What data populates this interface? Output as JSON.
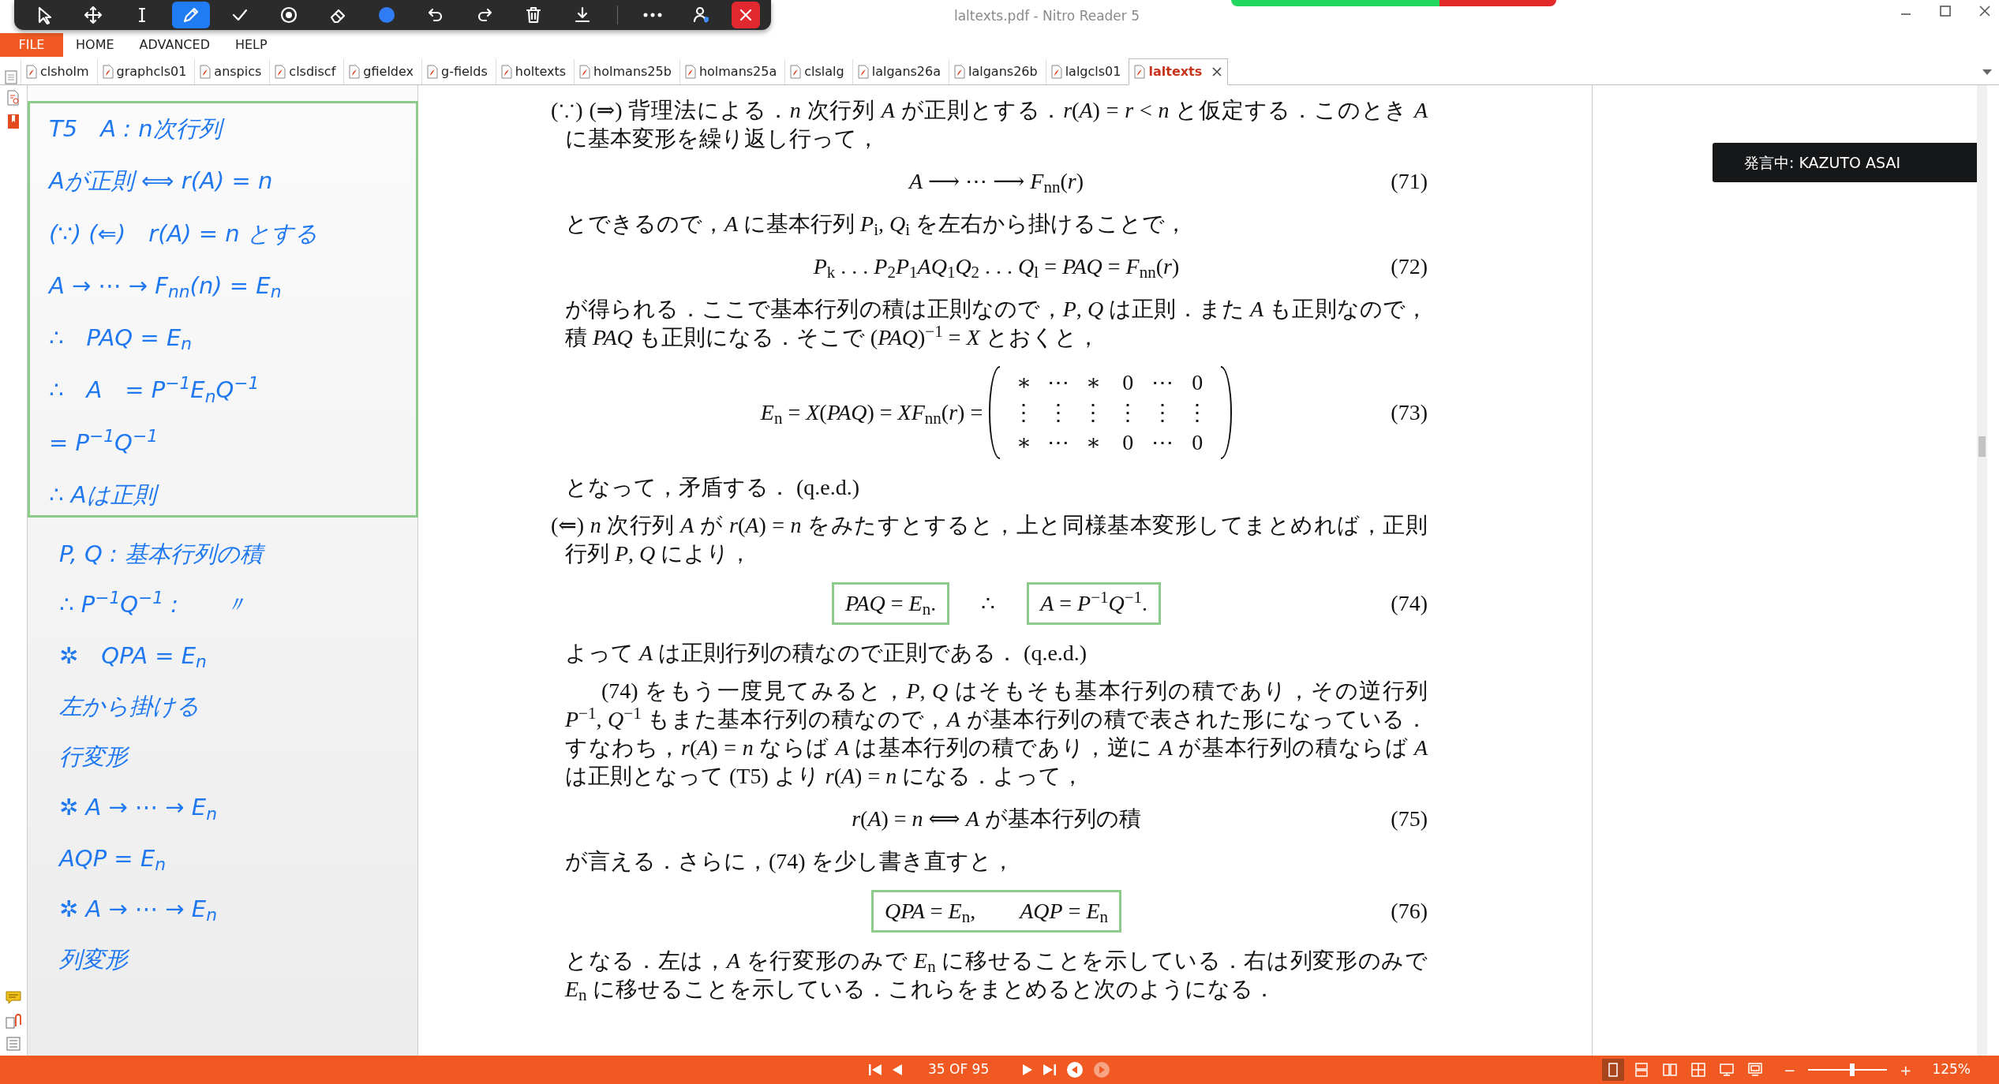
{
  "window": {
    "title": "laltexts.pdf - Nitro Reader 5"
  },
  "toolbar": {
    "tools": [
      {
        "kind": "pointer",
        "selected": false
      },
      {
        "kind": "move",
        "selected": false
      },
      {
        "kind": "text",
        "selected": false
      },
      {
        "kind": "pen",
        "selected": true
      },
      {
        "kind": "check",
        "selected": false
      },
      {
        "kind": "stamp",
        "selected": false
      },
      {
        "kind": "eraser",
        "selected": false
      },
      {
        "kind": "color",
        "selected": false
      },
      {
        "kind": "undo",
        "selected": false
      },
      {
        "kind": "redo",
        "selected": false
      },
      {
        "kind": "trash",
        "selected": false
      },
      {
        "kind": "download",
        "selected": false
      },
      {
        "kind": "more",
        "selected": false
      },
      {
        "kind": "user",
        "selected": false
      },
      {
        "kind": "close",
        "selected": false
      }
    ]
  },
  "menu": [
    {
      "label": "FILE",
      "selected": true
    },
    {
      "label": "HOME",
      "selected": false
    },
    {
      "label": "ADVANCED",
      "selected": false
    },
    {
      "label": "HELP",
      "selected": false
    }
  ],
  "tabs": [
    {
      "label": "clsholm",
      "selected": false
    },
    {
      "label": "graphcls01",
      "selected": false
    },
    {
      "label": "anspics",
      "selected": false
    },
    {
      "label": "clsdiscf",
      "selected": false
    },
    {
      "label": "gfieldex",
      "selected": false
    },
    {
      "label": "g-fields",
      "selected": false
    },
    {
      "label": "holtexts",
      "selected": false
    },
    {
      "label": "holmans25b",
      "selected": false
    },
    {
      "label": "holmans25a",
      "selected": false
    },
    {
      "label": "clslalg",
      "selected": false
    },
    {
      "label": "lalgans26a",
      "selected": false
    },
    {
      "label": "lalgans26b",
      "selected": false
    },
    {
      "label": "lalgcls01",
      "selected": false
    },
    {
      "label": "laltexts",
      "selected": true
    }
  ],
  "ink_notes": {
    "boxed_lines": [
      "T5　A : n次行列",
      "Aが正則 ⟺ r(A) = n",
      "(∵) (⇐)　r(A) = n とする",
      "A → ⋯ → F$_{nn}$(n) = E$_{n}$",
      "∴　PAQ = E$_{n}$",
      "∴　A　= P$^{−1}$E$_{n}$Q$^{−1}$",
      "= P$^{−1}$Q$^{−1}$",
      "∴ Aは正則"
    ],
    "lines": [
      "P, Q : 基本行列の積",
      "∴ P$^{−1}$Q$^{−1}$ :　　〃",
      "✲　QPA = E$_{n}$",
      "左から掛ける",
      "行変形",
      "✲ A → ⋯ → E$_{n}$",
      "AQP = E$_{n}$",
      "✲ A → ⋯ → E$_{n}$",
      "列変形"
    ]
  },
  "document": [
    {
      "kind": "hanging",
      "text": "(∵) (⇒) 背理法による．*n* 次行列 *A* が正則とする．*r*(*A*) = *r* < *n* と仮定する．このとき *A* に基本変形を繰り返し行って，"
    },
    {
      "kind": "equation",
      "parts": [
        {
          "text": "*A* ⟶ ⋯ ⟶ *F*$_{nn}$(*r*)",
          "boxed": false
        }
      ],
      "number": "(71)"
    },
    {
      "kind": "para",
      "text": "とできるので，*A* に基本行列 *P*$_{i}$, *Q*$_{i}$ を左右から掛けることで，"
    },
    {
      "kind": "equation",
      "parts": [
        {
          "text": "*P*$_{k}$ . . . *P*$_{2}$*P*$_{1}$*AQ*$_{1}$*Q*$_{2}$ . . . *Q*$_{l}$ = *PAQ* = *F*$_{nn}$(*r*)",
          "boxed": false
        }
      ],
      "number": "(72)"
    },
    {
      "kind": "para",
      "text": "が得られる．ここで基本行列の積は正則なので，*P*, *Q* は正則．また *A* も正則なので，積 *PAQ* も正則になる．そこで (*PAQ*)$^{−1}$ = *X* とおくと，"
    },
    {
      "kind": "matrix",
      "lhs": "*E*$_{n}$ = *X*(*PAQ*) = *XF*$_{nn}$(*r*) =",
      "rows": [
        [
          "∗",
          "⋯",
          "∗",
          "0",
          "⋯",
          "0"
        ],
        [
          "⋮",
          "⋮",
          "⋮",
          "⋮",
          "⋮",
          "⋮"
        ],
        [
          "∗",
          "⋯",
          "∗",
          "0",
          "⋯",
          "0"
        ]
      ],
      "number": "(73)"
    },
    {
      "kind": "para",
      "text": "となって，矛盾する． (q.e.d.)"
    },
    {
      "kind": "hanging",
      "text": "(⇐) *n* 次行列 *A* が *r*(*A*) = *n* をみたすとすると，上と同様基本変形してまとめれば，正則行列 *P*, *Q* により，"
    },
    {
      "kind": "equation",
      "parts": [
        {
          "text": "*PAQ* = *E*$_{n}$.",
          "boxed": true
        },
        {
          "text": "∴",
          "boxed": false
        },
        {
          "text": "*A* = *P*$^{−1}$*Q*$^{−1}$.",
          "boxed": true
        }
      ],
      "number": "(74)"
    },
    {
      "kind": "para",
      "text": "よって *A* は正則行列の積なので正則である． (q.e.d.)"
    },
    {
      "kind": "indented",
      "text": "(74) をもう一度見てみると，*P*, *Q* はそもそも基本行列の積であり，その逆行列 *P*$^{−1}$, *Q*$^{−1}$ もまた基本行列の積なので，*A* が基本行列の積で表された形になっている．すなわち，*r*(*A*) = *n* ならば *A* は基本行列の積であり，逆に *A* が基本行列の積ならば *A* は正則となって (T5) より *r*(*A*) = *n* になる．よって，"
    },
    {
      "kind": "equation",
      "parts": [
        {
          "text": "*r*(*A*) = *n* ⟺ *A* が基本行列の積",
          "boxed": false
        }
      ],
      "number": "(75)"
    },
    {
      "kind": "para",
      "text": "が言える．さらに，(74) を少し書き直すと，"
    },
    {
      "kind": "equation",
      "parts": [
        {
          "text": "*QPA* = *E*$_{n}$,        *AQP* = *E*$_{n}$",
          "boxed": true
        }
      ],
      "number": "(76)"
    },
    {
      "kind": "para",
      "text": "となる．左は，*A* を行変形のみで *E*$_{n}$ に移せることを示している．右は列変形のみで *E*$_{n}$ に移せることを示している．これらをまとめると次のようになる．"
    }
  ],
  "toast": {
    "text": "発言中: KAZUTO ASAI"
  },
  "status_bar": {
    "page": "35 OF 95",
    "history": [
      {
        "disabled": false
      },
      {
        "disabled": true
      }
    ],
    "view_modes": [
      {
        "kind": "single",
        "selected": true
      },
      {
        "kind": "continuous",
        "selected": false
      },
      {
        "kind": "facing",
        "selected": false
      },
      {
        "kind": "grid",
        "selected": false
      },
      {
        "kind": "screen",
        "selected": false
      },
      {
        "kind": "present",
        "selected": false
      }
    ],
    "zoom": {
      "minus": "−",
      "plus": "+",
      "level": 0.56,
      "reading": "125%"
    }
  }
}
